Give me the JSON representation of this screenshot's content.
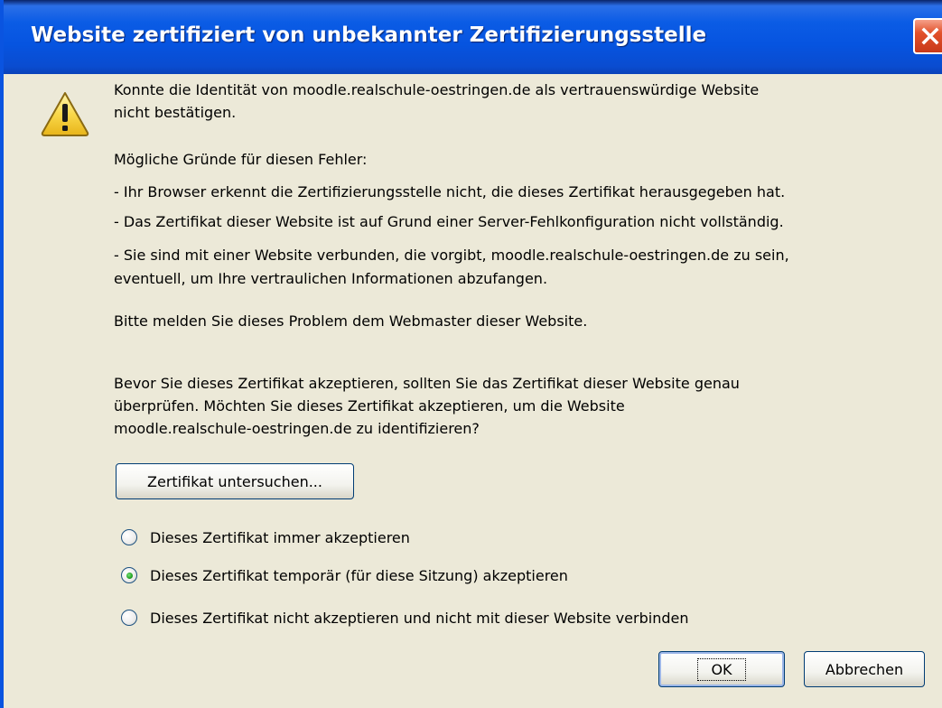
{
  "window": {
    "title": "Website zertifiziert von unbekannter Zertifizierungsstelle"
  },
  "icons": {
    "warning": "warning-icon",
    "close": "close-icon"
  },
  "message": {
    "intro_line1": "Konnte die Identität von moodle.realschule-oestringen.de als vertrauenswürdige Website",
    "intro_line2": "nicht bestätigen.",
    "reasons_heading": "Mögliche Gründe für diesen Fehler:",
    "reason1": "- Ihr Browser erkennt die Zertifizierungsstelle nicht, die dieses Zertifikat herausgegeben hat.",
    "reason2": "- Das Zertifikat dieser Website ist auf Grund einer Server-Fehlkonfiguration nicht vollständig.",
    "reason3_line1": "- Sie sind mit einer Website verbunden, die vorgibt, moodle.realschule-oestringen.de zu sein,",
    "reason3_line2": "eventuell, um Ihre vertraulichen Informationen abzufangen.",
    "report": "Bitte melden Sie dieses Problem dem Webmaster dieser Website.",
    "question_line1": "Bevor Sie dieses Zertifikat akzeptieren, sollten Sie das Zertifikat dieser Website genau",
    "question_line2": "überprüfen. Möchten Sie dieses Zertifikat akzeptieren, um die Website",
    "question_line3": "moodle.realschule-oestringen.de zu identifizieren?"
  },
  "examine_button": "Zertifikat untersuchen...",
  "options": [
    {
      "label": "Dieses Zertifikat immer akzeptieren",
      "selected": false
    },
    {
      "label": "Dieses Zertifikat temporär (für diese Sitzung) akzeptieren",
      "selected": true
    },
    {
      "label": "Dieses Zertifikat nicht akzeptieren und nicht mit dieser Website verbinden",
      "selected": false
    }
  ],
  "buttons": {
    "ok": "OK",
    "cancel": "Abbrechen"
  },
  "colors": {
    "titlebar": "#0654e0",
    "dialog_bg": "#ece9d8",
    "close_button": "#e2512a",
    "radio_checked": "#21a121"
  }
}
